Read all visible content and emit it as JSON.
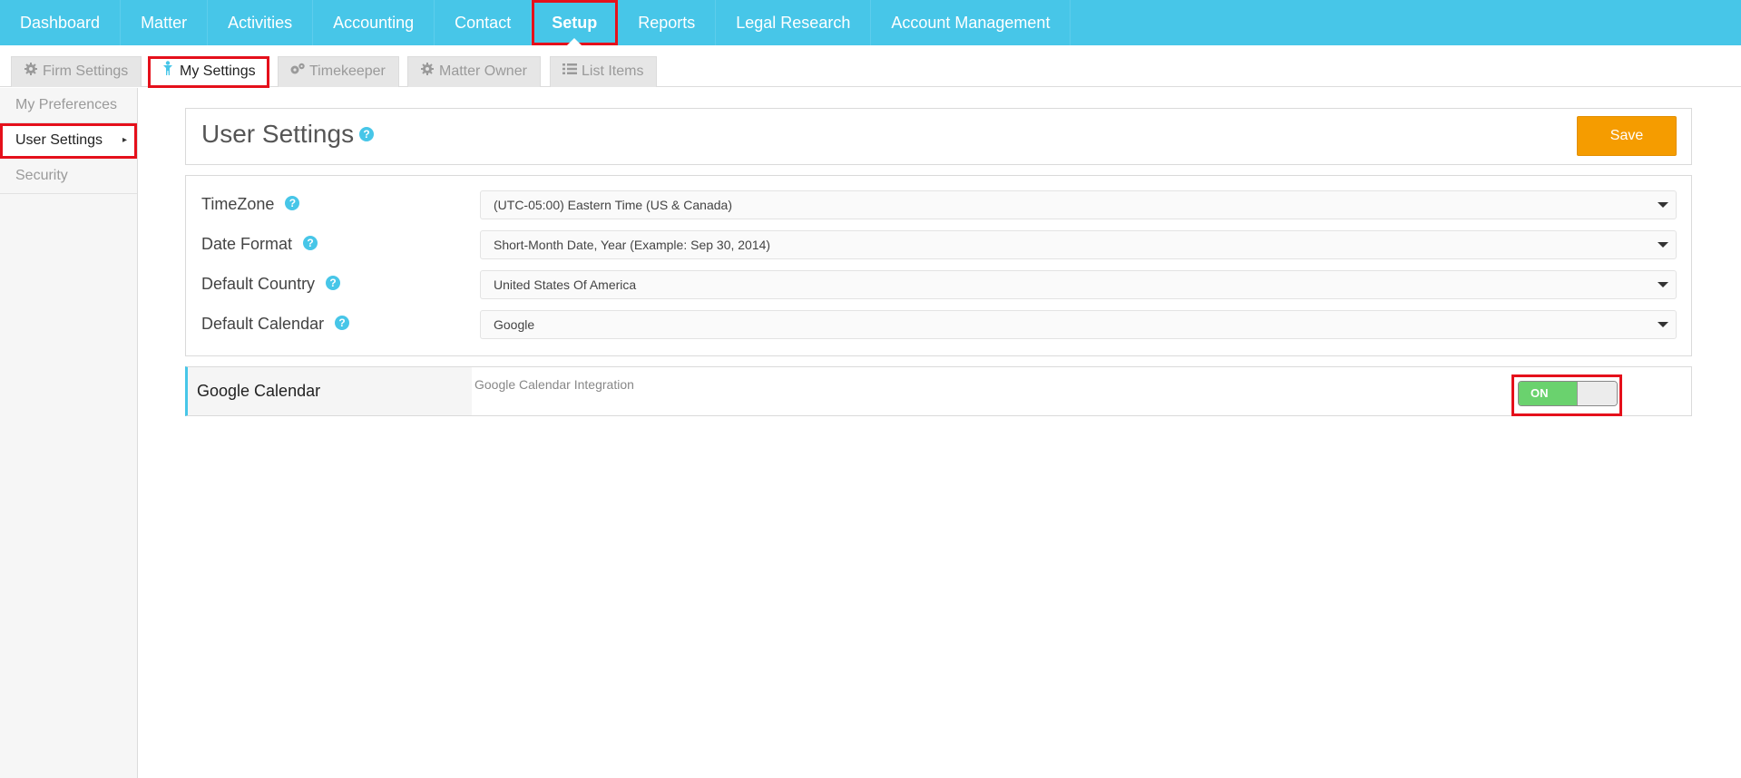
{
  "topnav": {
    "items": [
      "Dashboard",
      "Matter",
      "Activities",
      "Accounting",
      "Contact",
      "Setup",
      "Reports",
      "Legal Research",
      "Account Management"
    ],
    "active": "Setup"
  },
  "subtabs": {
    "firm_settings": "Firm Settings",
    "my_settings": "My Settings",
    "timekeeper": "Timekeeper",
    "matter_owner": "Matter Owner",
    "list_items": "List Items"
  },
  "sidebar": {
    "items": [
      "My Preferences",
      "User Settings",
      "Security"
    ],
    "active": "User Settings"
  },
  "header": {
    "title": "User Settings",
    "help_glyph": "?",
    "save_label": "Save"
  },
  "form": {
    "help_glyph": "?",
    "timezone": {
      "label": "TimeZone",
      "value": "(UTC-05:00) Eastern Time (US & Canada)"
    },
    "date_format": {
      "label": "Date Format",
      "value": "Short-Month Date, Year (Example: Sep 30, 2014)"
    },
    "default_country": {
      "label": "Default Country",
      "value": "United States Of America"
    },
    "default_calendar": {
      "label": "Default Calendar",
      "value": "Google"
    }
  },
  "google_calendar": {
    "label": "Google Calendar",
    "description": "Google Calendar Integration",
    "toggle_label": "ON",
    "enabled": true
  },
  "colors": {
    "nav_bg": "#47c6e8",
    "save_btn": "#f59c00",
    "toggle_on": "#6ad26e",
    "highlight_box": "#e5101b"
  },
  "icons": {
    "firm_settings": "gear-icon",
    "my_settings": "user-icon",
    "timekeeper": "gears-icon",
    "matter_owner": "gear-icon",
    "list_items": "list-icon",
    "help": "question-circle-icon",
    "dropdown": "caret-down-icon",
    "sidebar_active": "caret-right-icon"
  }
}
